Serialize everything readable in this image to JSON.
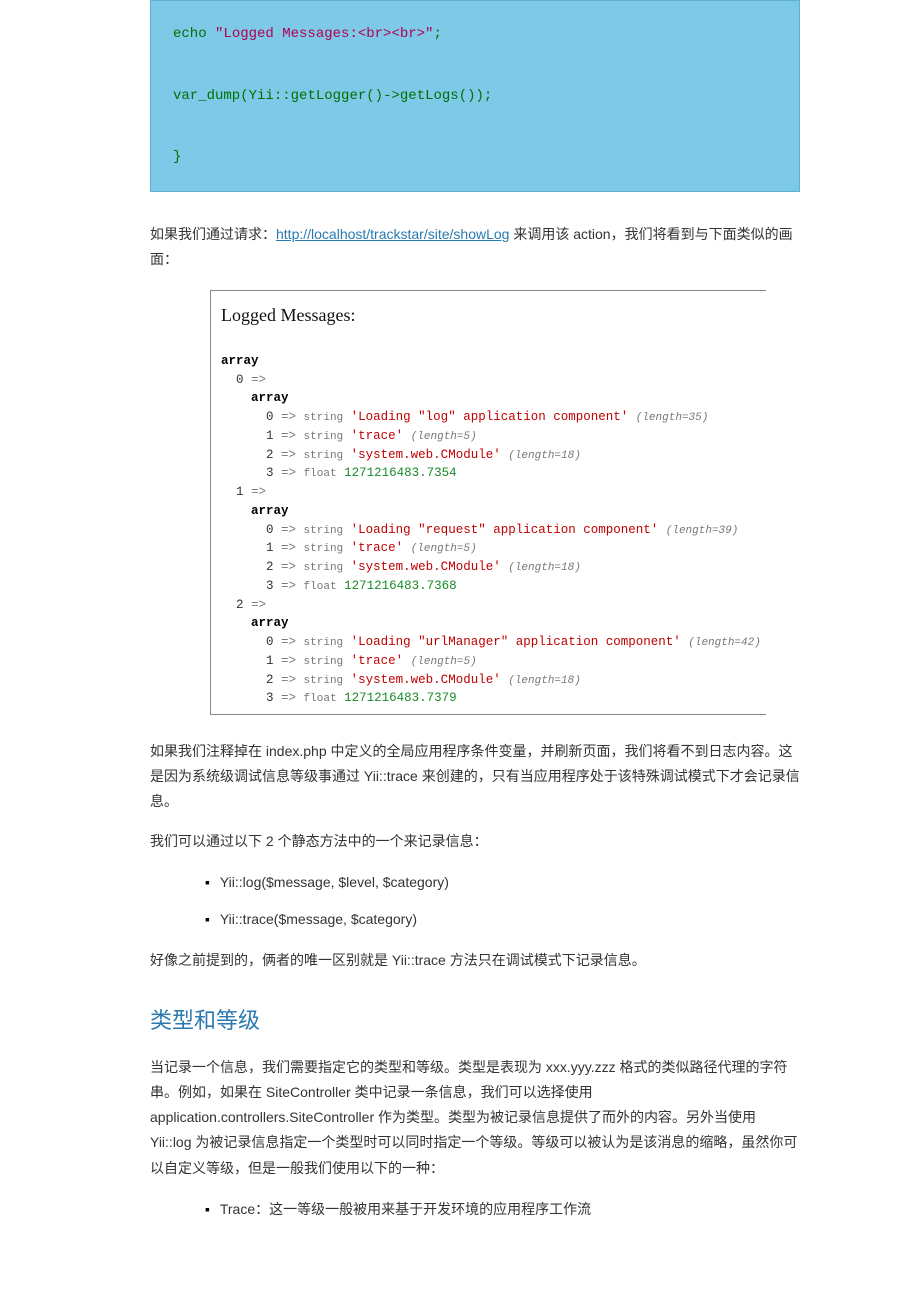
{
  "code": {
    "line1_kw": "echo",
    "line1_str": "\"Logged Messages:<br><br>\"",
    "line1_end": ";",
    "line2a": "var_dump",
    "line2b": "(Yii",
    "line2c": "::",
    "line2d": "getLogger",
    "line2e": "()",
    "line2f": "->",
    "line2g": "getLogs",
    "line2h": "())",
    "line2end": ";",
    "brace": "}"
  },
  "para1_a": "如果我们通过请求：",
  "para1_link": "http://localhost/trackstar/site/showLog",
  "para1_b": " 来调用该 action，我们将看到与下面类似的画面：",
  "output": {
    "header": "Logged Messages:",
    "entries": [
      {
        "idx": "0",
        "s0": "'Loading \"log\" application component'",
        "l0": "(length=35)",
        "s1": "'trace'",
        "l1": "(length=5)",
        "s2": "'system.web.CModule'",
        "l2": "(length=18)",
        "f": "1271216483.7354"
      },
      {
        "idx": "1",
        "s0": "'Loading \"request\" application component'",
        "l0": "(length=39)",
        "s1": "'trace'",
        "l1": "(length=5)",
        "s2": "'system.web.CModule'",
        "l2": "(length=18)",
        "f": "1271216483.7368"
      },
      {
        "idx": "2",
        "s0": "'Loading \"urlManager\" application component'",
        "l0": "(length=42)",
        "s1": "'trace'",
        "l1": "(length=5)",
        "s2": "'system.web.CModule'",
        "l2": "(length=18)",
        "f": "1271216483.7379"
      }
    ]
  },
  "para2": "如果我们注释掉在 index.php 中定义的全局应用程序条件变量，并刷新页面，我们将看不到日志内容。这是因为系统级调试信息等级事通过 Yii::trace 来创建的，只有当应用程序处于该特殊调试模式下才会记录信息。",
  "para3": "我们可以通过以下 2 个静态方法中的一个来记录信息：",
  "methods": {
    "m1": "Yii::log($message, $level, $category)",
    "m2": "Yii::trace($message, $category)"
  },
  "para4": "好像之前提到的，俩者的唯一区别就是 Yii::trace 方法只在调试模式下记录信息。",
  "h2": "类型和等级",
  "para5": "当记录一个信息，我们需要指定它的类型和等级。类型是表现为 xxx.yyy.zzz 格式的类似路径代理的字符串。例如，如果在 SiteController 类中记录一条信息，我们可以选择使用 application.controllers.SiteController 作为类型。类型为被记录信息提供了而外的内容。另外当使用 Yii::log 为被记录信息指定一个类型时可以同时指定一个等级。等级可以被认为是该消息的缩略，虽然你可以自定义等级，但是一般我们使用以下的一种：",
  "methods2": {
    "m1": "Trace：这一等级一般被用来基于开发环境的应用程序工作流"
  }
}
